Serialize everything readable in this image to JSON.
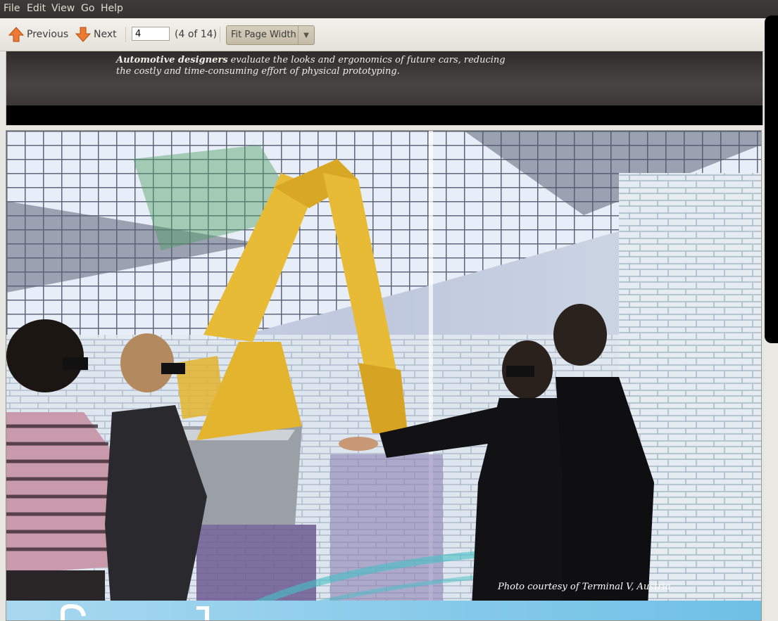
{
  "menu": {
    "file": "File",
    "edit": "Edit",
    "view": "View",
    "go": "Go",
    "help": "Help"
  },
  "toolbar": {
    "previous_label": "Previous",
    "next_label": "Next",
    "page_value": "4",
    "page_count": "(4 of 14)",
    "zoom_label": "Fit Page Width"
  },
  "document": {
    "caption_bold": "Automotive designers",
    "caption_rest": " evaluate the looks and ergonomics of future cars, reducing the costly and time-consuming effort of physical prototyping.",
    "photo_credit": "Photo courtesy of  Terminal V, Austria."
  },
  "colors": {
    "menubar": "#3c3b37",
    "toolbar": "#ece9e2",
    "arrow": "#e8702a",
    "robot": "#e4b62e"
  }
}
